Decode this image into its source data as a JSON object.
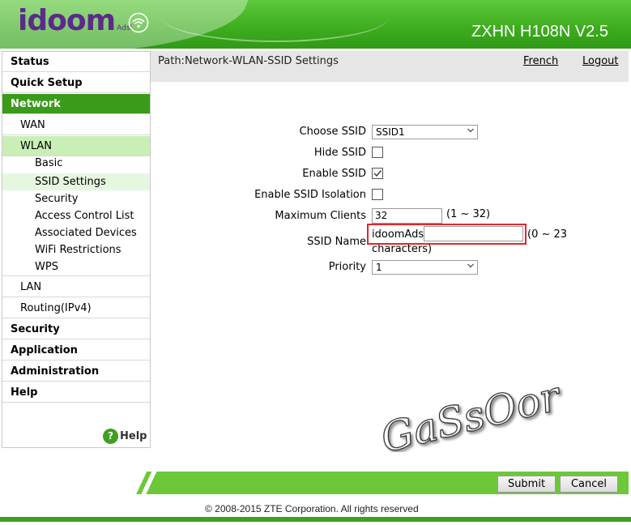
{
  "header": {
    "logo_text": "idoom",
    "logo_sub": "Adsl",
    "model": "ZXHN H108N V2.5"
  },
  "colors": {
    "brand_green": "#3ea020",
    "active_nav": "#3a9a1a",
    "logo_purple": "#5b2a8c",
    "highlight_red": "#e0272d"
  },
  "sidebar": {
    "items": [
      {
        "label": "Status"
      },
      {
        "label": "Quick Setup"
      },
      {
        "label": "Network"
      },
      {
        "label": "WAN"
      },
      {
        "label": "WLAN"
      },
      {
        "label": "Basic"
      },
      {
        "label": "SSID Settings"
      },
      {
        "label": "Security"
      },
      {
        "label": "Access Control List"
      },
      {
        "label": "Associated Devices"
      },
      {
        "label": "WiFi Restrictions"
      },
      {
        "label": "WPS"
      },
      {
        "label": "LAN"
      },
      {
        "label": "Routing(IPv4)"
      },
      {
        "label": "Security"
      },
      {
        "label": "Application"
      },
      {
        "label": "Administration"
      },
      {
        "label": "Help"
      }
    ],
    "help_label": "Help",
    "help_icon_glyph": "?"
  },
  "topbar": {
    "path": "Path:Network-WLAN-SSID Settings",
    "french": "French",
    "logout": "Logout"
  },
  "form": {
    "choose_ssid_label": "Choose SSID",
    "choose_ssid_value": "SSID1",
    "hide_ssid_label": "Hide SSID",
    "hide_ssid_checked": false,
    "enable_ssid_label": "Enable SSID",
    "enable_ssid_checked": true,
    "isolation_label": "Enable SSID Isolation",
    "isolation_checked": false,
    "max_clients_label": "Maximum Clients",
    "max_clients_value": "32",
    "max_clients_hint": "(1 ~ 32)",
    "ssid_name_label": "SSID Name",
    "ssid_name_value": "idoomAdsl",
    "ssid_name_hint_a": "(0 ~ 23",
    "ssid_name_hint_b": "characters)",
    "priority_label": "Priority",
    "priority_value": "1"
  },
  "watermark": "GaSsOor",
  "footer": {
    "submit": "Submit",
    "cancel": "Cancel",
    "copyright": "© 2008-2015 ZTE Corporation. All rights reserved"
  }
}
